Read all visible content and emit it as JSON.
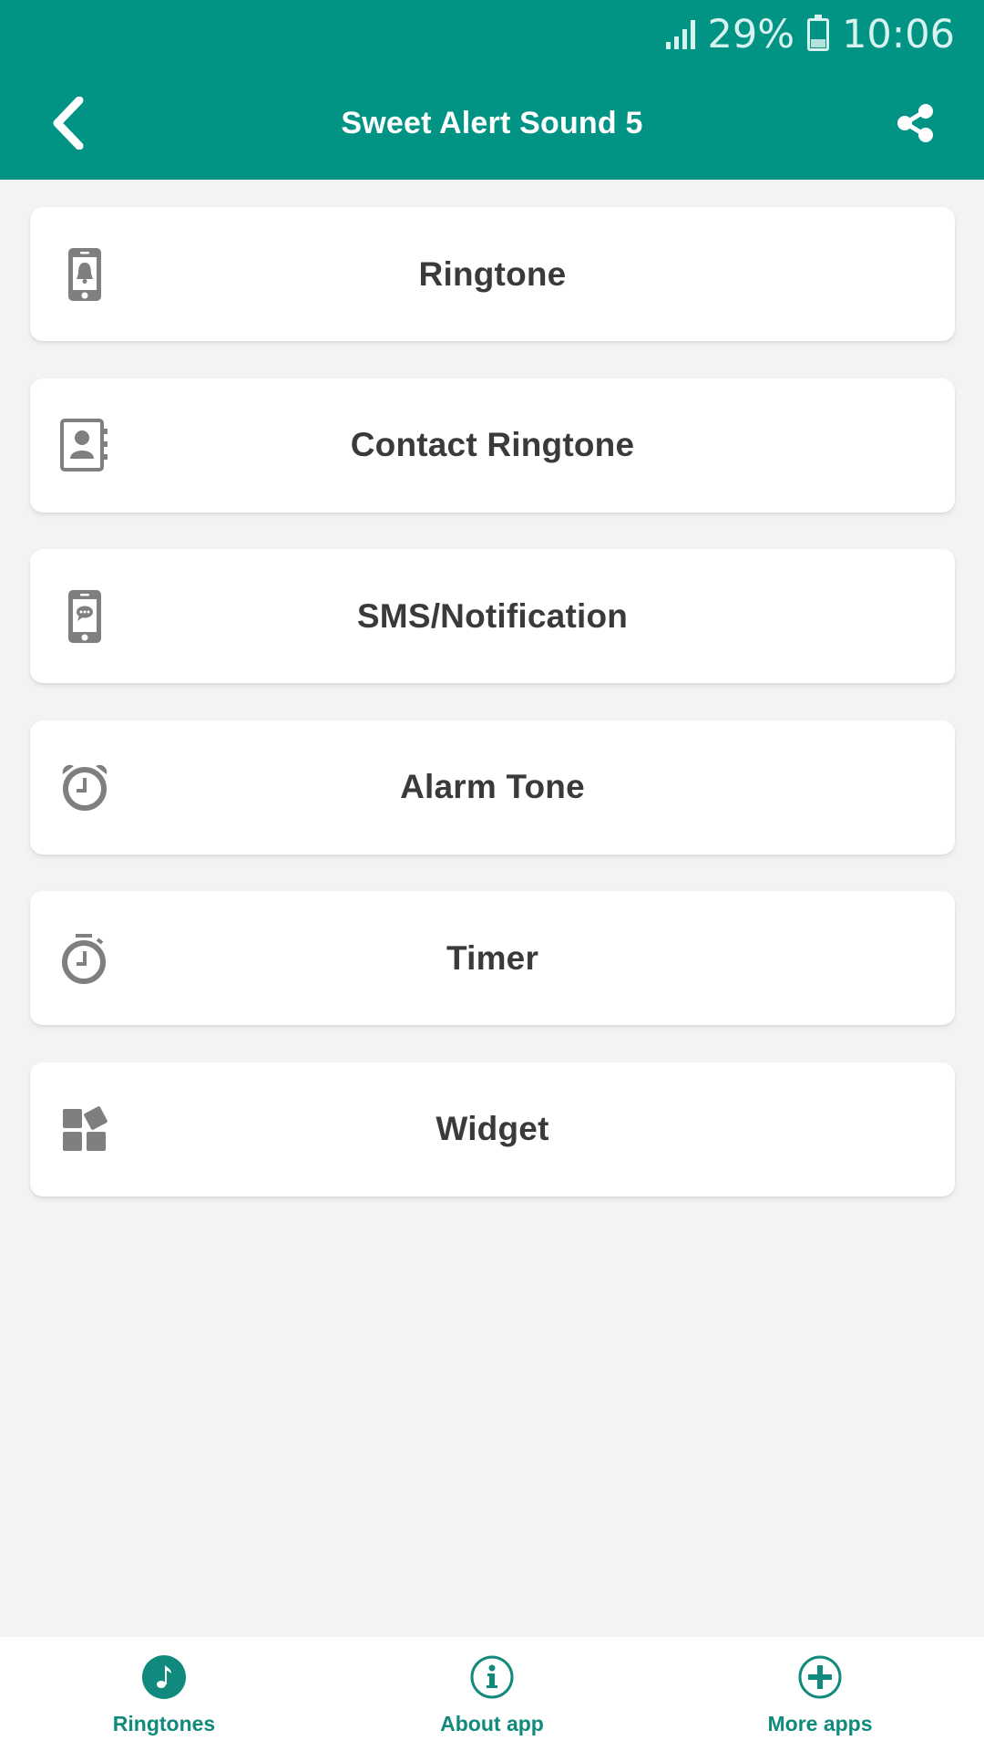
{
  "status_bar": {
    "battery_percent": "29%",
    "time": "10:06",
    "signal_icon": "signal-icon",
    "battery_icon": "battery-icon"
  },
  "app_bar": {
    "title": "Sweet Alert Sound 5",
    "back_icon": "chevron-left-icon",
    "share_icon": "share-icon"
  },
  "menu": {
    "items": [
      {
        "label": "Ringtone",
        "icon": "phone-bell-icon"
      },
      {
        "label": "Contact Ringtone",
        "icon": "contact-book-icon"
      },
      {
        "label": "SMS/Notification",
        "icon": "phone-message-icon"
      },
      {
        "label": "Alarm Tone",
        "icon": "alarm-clock-icon"
      },
      {
        "label": "Timer",
        "icon": "stopwatch-icon"
      },
      {
        "label": "Widget",
        "icon": "widget-icon"
      }
    ]
  },
  "bottom_nav": {
    "items": [
      {
        "label": "Ringtones",
        "icon": "music-note-icon",
        "active": true
      },
      {
        "label": "About app",
        "icon": "info-icon",
        "active": false
      },
      {
        "label": "More apps",
        "icon": "plus-circle-icon",
        "active": false
      }
    ]
  },
  "colors": {
    "primary": "#019485",
    "nav_accent": "#108a7c",
    "icon_gray": "#7f7f7f",
    "text": "#3a3a3a",
    "background": "#f3f3f3"
  }
}
